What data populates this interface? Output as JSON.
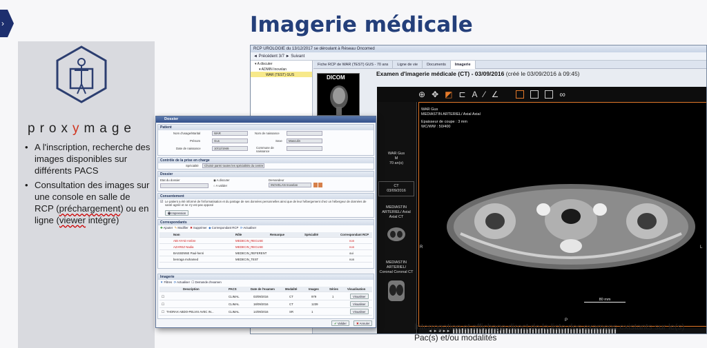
{
  "slide": {
    "title": "Imagerie médicale",
    "brand_pre": "prox",
    "brand_y": "y",
    "brand_post": "mage",
    "bullet1": "A l'inscription, recherche des images disponibles sur différents PACS",
    "bullet2_pre": "Consultation des images sur une console en salle de RCP (",
    "bullet2_u1": "préchargement",
    "bullet2_mid": ") ou en ligne (",
    "bullet2_u2": "viewer",
    "bullet2_post": " intégré)",
    "caption": "Interrogation et affichage direct de la liste des examens existants sur le(s) Pac(s) et/ou modalités"
  },
  "app": {
    "titlebar": "RCP UROLOGIE du 13/12/2017 se déroulant à Réseau Oncomed",
    "toolbar": "◄ Précédent  3/7    ► Suivant",
    "tree": [
      "▾ A discuter",
      "▾ ADMIN Inovelan",
      "WAR (TEST) GUS"
    ],
    "tabs": [
      "Fiche RCP de WAR (TEST) GUS - 70 ans",
      "Ligne de vie",
      "Documents",
      "Imagerie"
    ],
    "dicom_label": "DICOM",
    "exam_title": "Examen d'imagerie médicale (CT) - 03/09/2016",
    "exam_created": "(créé le 03/09/2016 à 09:45)"
  },
  "viewer": {
    "series": [
      {
        "l1": "WAR Gus",
        "l2": "M",
        "l3": "70 an(s)"
      },
      {
        "l1": "CT",
        "l2": "03/09/2016",
        "l3": ""
      },
      {
        "l1": "MEDIASTIN",
        "l2": "ARTERIEL/ Axial",
        "l3": "Axial CT"
      },
      {
        "l1": "MEDIASTIN",
        "l2": "ARTERIEL/",
        "l3": "Coronal Coronal CT"
      }
    ],
    "info1": "WAR Gus",
    "info2": "MEDIASTIN ARTERIEL/ Axial Axial",
    "info3": "Epaisseur de coupe : 3 mm",
    "info4": "WC/WW : 50/400",
    "scale_label": "80 mm",
    "side_r": "R",
    "side_l": "L",
    "side_p": "P"
  },
  "dossier": {
    "title": "Dossier",
    "patient_hd": "Patient",
    "nom_usage_lbl": "Nom d'usage/Marital",
    "nom_usage": "WAR",
    "nom_naissance_lbl": "Nom de naissance",
    "prenom_lbl": "Prénom",
    "prenom": "Gus",
    "sexe_lbl": "Sexe",
    "sexe": "Masculin",
    "ddn_lbl": "Date de naissance",
    "ddn": "10/12/1946",
    "commune_lbl": "Commune de naissance",
    "ctrl_hd": "Contrôle de la prise en charge",
    "specialite_lbl": "Spécialité",
    "specialite": "Choisir parmi toutes les spécialités du centre",
    "dossier_hd": "Dossier",
    "etat_lbl": "Etat du dossier",
    "radio1": "A discuter",
    "radio2": "A valider",
    "demandeur_lbl": "Demandeur",
    "demandeur": "INOVELAN Inovelan",
    "consent_hd": "Consentement",
    "consent_text": "Le patient a été informé de l'informatisation et du partage de ses données personnelles ainsi que de leur hébergement chez un hébergeur de données de santé agréé et ne s'y est pas opposé",
    "impression": "Impression",
    "corr_hd": "Correspondants",
    "corr_btns": [
      "Ajouter",
      "Modifier",
      "Supprimer",
      "Correspondant RCP",
      "Actualiser"
    ],
    "corr_cols": [
      "Nom",
      "Rôle",
      "Remarque",
      "Spécialité",
      "Correspondant RCP"
    ],
    "corr_rows": [
      {
        "nom": "ABI AYAD Ambre",
        "role": "MEDECIN_RECUSE",
        "rcp": "non"
      },
      {
        "nom": "AZAREZ Nadia",
        "role": "MEDECIN_RECUSE",
        "rcp": "non"
      },
      {
        "nom": "BASSENNE Paul-henri",
        "role": "MEDECIN_REFERENT",
        "rcp": "oui"
      },
      {
        "nom": "benraga mohamed",
        "role": "MEDECIN_TEST",
        "rcp": "non"
      }
    ],
    "img_hd": "Imagerie",
    "img_btns": [
      "Filtres",
      "Actualiser",
      "Demande d'examen"
    ],
    "img_cols": [
      "Description",
      "PACS",
      "Date de l'examen",
      "Modalité",
      "Images",
      "Séries",
      "Visualisation"
    ],
    "img_rows": [
      {
        "desc": "",
        "pacs": "CLIMAL",
        "date": "03/09/2016",
        "mod": "CT",
        "images": "979",
        "series": "1",
        "vis": "Visualiser"
      },
      {
        "desc": "",
        "pacs": "CLIMAL",
        "date": "18/09/2016",
        "mod": "CT",
        "images": "1239",
        "series": "",
        "vis": "Visualiser"
      },
      {
        "desc": "THORAX ABDO-PELVIS AVEC IN...",
        "pacs": "CLIMAL",
        "date": "14/09/2016",
        "mod": "SR",
        "images": "1",
        "series": "",
        "vis": "Visualiser"
      }
    ],
    "valider": "Valider",
    "annuler": "Annuler"
  }
}
